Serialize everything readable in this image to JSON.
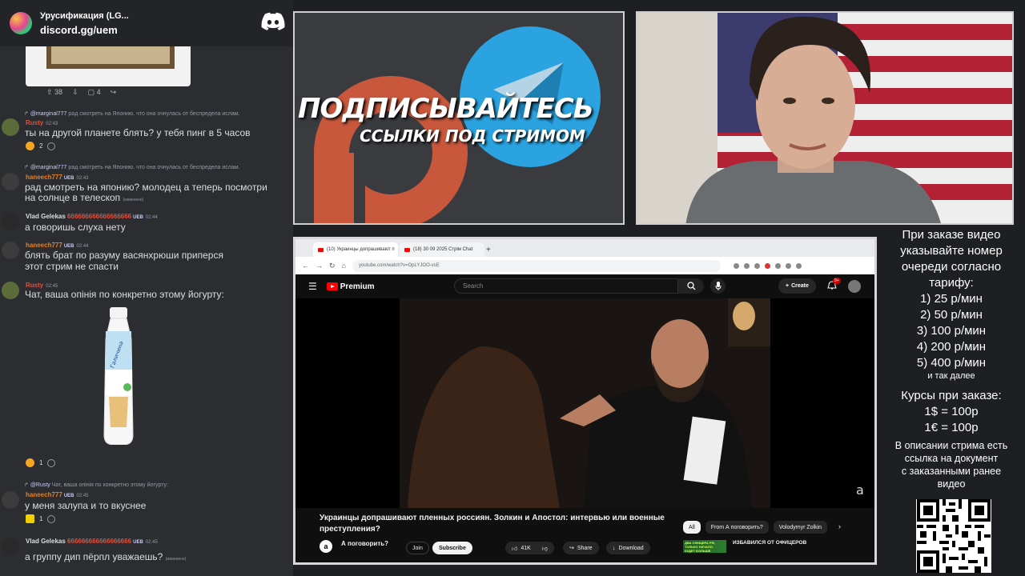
{
  "discord": {
    "server_name": "Урусификация (LG...",
    "invite": "discord.gg/uem",
    "embed_stats": {
      "likes": "38",
      "comments": "4"
    },
    "messages": [
      {
        "reply_user": "@marginal777",
        "reply_text": "рад смотреть на Японию. что она очнулась от беспредела ислам.",
        "user": "Rusty",
        "user_color": "#e0513e",
        "time": "02:43",
        "text": "ты на другой планете блять? у тебя пинг в 5 часов",
        "reaction_count": "2"
      },
      {
        "reply_user": "@marginal777",
        "reply_text": "рад смотреть на Японию. что она очнулась от беспредела ислам.",
        "user": "haneech777",
        "badge": "UEB",
        "user_color": "#e67e22",
        "time": "02:43",
        "text_line1": "рад смотреть на японию? молодец а теперь посмотри",
        "text_line2": "на солнце в телескоп",
        "edited": "(изменено)"
      },
      {
        "user": "Vlad Gelekas",
        "user_suffix": "666666666666666666",
        "badge": "UEB",
        "user_color": "#ffffff",
        "time": "02:44",
        "text": "а говоришь слуха нету"
      },
      {
        "user": "haneech777",
        "badge": "UEB",
        "user_color": "#e67e22",
        "time": "02:44",
        "text_line1": "блять брат по разуму васянхрюши приперся",
        "text_line2": "этот стрим не спасти"
      },
      {
        "user": "Rusty",
        "user_color": "#e0513e",
        "time": "02:45",
        "text": "Чат, ваша опінія по конкретно этому йогурту:",
        "reaction_count": "1"
      },
      {
        "reply_user": "@Rusty",
        "reply_text": "Чат, ваша опінія по конкретно этому йогурту:",
        "user": "haneech777",
        "badge": "UEB",
        "user_color": "#e67e22",
        "time": "02:45",
        "text": "у меня залупа и то вкуснее",
        "reaction_count": "1"
      },
      {
        "user": "Vlad Gelekas",
        "user_suffix": "666666666666666666",
        "badge": "UEB",
        "user_color": "#ffffff",
        "time": "02:45",
        "text": "а группу дип пёрпл уважаешь?",
        "edited": "(изменено)"
      }
    ]
  },
  "promo": {
    "title": "ПОДПИСЫВАЙТЕСЬ",
    "subtitle": "ССЫЛКИ ПОД СТРИМОМ"
  },
  "browser": {
    "tabs": [
      "(10) Украинцы допрашивают п",
      "(18) 30 09 2025 Стрім Chat"
    ],
    "url": "youtube.com/watch?v=OpLYJOO-vsE",
    "yt": {
      "logo": "Premium",
      "search_placeholder": "Search",
      "create_label": "Create",
      "notif_count": "9+",
      "video_title": "Украинцы допрашивают пленных россиян. Золкин и Апостол: интервью или военные преступления?",
      "channel": "А поговорить?",
      "join": "Join",
      "subscribe": "Subscribe",
      "likes": "41K",
      "share": "Share",
      "download": "Download",
      "chips": [
        "All",
        "From А поговорить?",
        "Volodymyr Zolkin"
      ],
      "rec_title": "ИЗБАВИЛСЯ ОТ ОФИЦЕРОВ",
      "rec_thumb_text": "ДВА ОФИЦЕРА РФ, ТОЛЬКО НАЧАЛО. БУДЕТ БОЛЬШЕ"
    }
  },
  "info_panel": {
    "intro": [
      "При заказе видео",
      "указывайте номер",
      "очереди согласно",
      "тарифу:"
    ],
    "tariffs": [
      "1) 25 р/мин",
      "2) 50 р/мин",
      "3) 100 р/мин",
      "4) 200 р/мин",
      "5) 400 р/мин"
    ],
    "etc": "и так далее",
    "rates_title": "Курсы при заказе:",
    "rates": [
      "1$ = 100р",
      "1€ = 100р"
    ],
    "desc": [
      "В описании стрима есть",
      "ссылка на документ",
      "с заказанными ранее",
      "видео"
    ]
  },
  "colors": {
    "discord_bg": "#2b2d31",
    "yt_red": "#ff0000",
    "telegram_blue": "#2aa3e0",
    "patreon_orange": "#c9573c"
  }
}
